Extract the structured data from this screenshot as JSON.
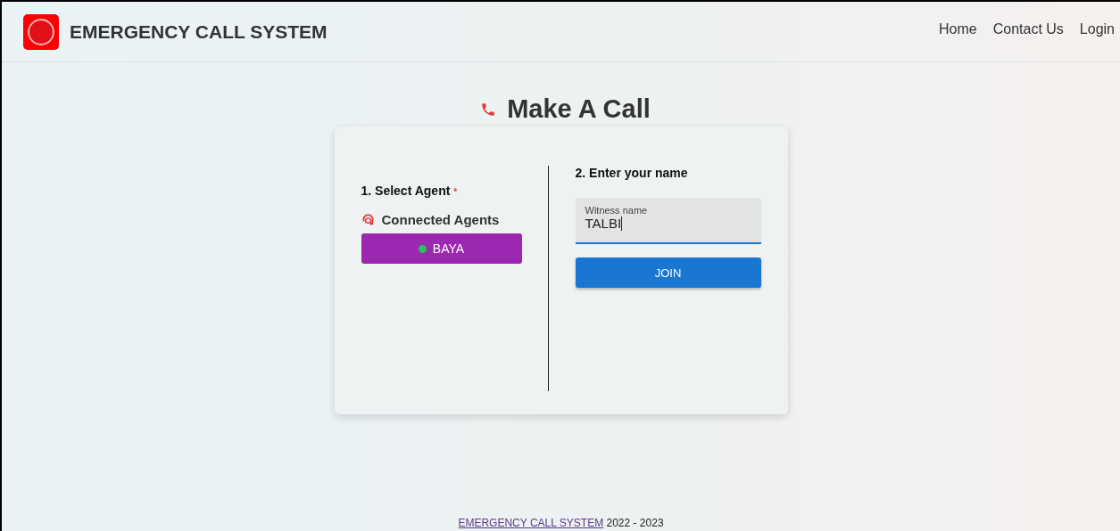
{
  "header": {
    "title": "EMERGENCY CALL SYSTEM",
    "nav": [
      {
        "label": "Home"
      },
      {
        "label": "Contact Us"
      },
      {
        "label": "Login"
      }
    ]
  },
  "page_title": "Make A Call",
  "select_agent": {
    "heading": "1. Select Agent",
    "required_mark": "*",
    "subheading": "Connected Agents",
    "agents": [
      {
        "name": "BAYA",
        "color": "#22c55e"
      }
    ]
  },
  "enter_name": {
    "heading": "2. Enter your name",
    "field": {
      "label": "Witness name",
      "value": "TALBI"
    },
    "button": "JOIN"
  },
  "footer": {
    "link": "EMERGENCY CALL SYSTEM",
    "text": "2022 - 2023"
  }
}
